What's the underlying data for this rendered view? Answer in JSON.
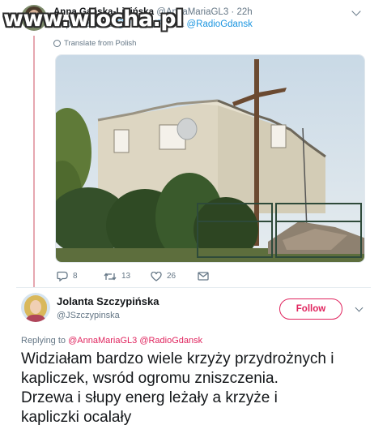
{
  "watermark": "www.wiocha.pl",
  "retweeted_tweet": {
    "author_name": "Anna Gańska-Lipińska",
    "author_handle": "@AnnaMariaGL3",
    "time": "· 22h",
    "line2_prefix": "Odpowiedź do",
    "line2_handle": "@PZCHURA",
    "line2_via": "via",
    "line2_via_handle": "@RadioGdansk",
    "translate_label": "Translate from Polish",
    "actions": {
      "reply_count": "8",
      "retweet_count": "13",
      "like_count": "26"
    }
  },
  "main_tweet": {
    "author_name": "Jolanta Szczypińska",
    "author_handle": "@JSzczypinska",
    "follow_label": "Follow",
    "replying_prefix": "Replying to",
    "replying_handles": "@AnnaMariaGL3 @RadioGdansk",
    "text_lines": [
      "Widziałam bardzo wiele krzyży przydrożnych i",
      "kapliczek, wsród ogromu zniszczenia.",
      "Drzewa i słupy energ leżały a  krzyże i",
      "kapliczki ocalały"
    ]
  },
  "colors": {
    "accent_pink": "#e0245e",
    "link_blue": "#1b95e0",
    "muted_gray": "#657786"
  },
  "icons": {
    "reply": "reply-icon",
    "retweet": "retweet-icon",
    "like": "heart-icon",
    "dm": "envelope-icon",
    "translate": "globe-icon",
    "more": "chevron-down-icon"
  }
}
